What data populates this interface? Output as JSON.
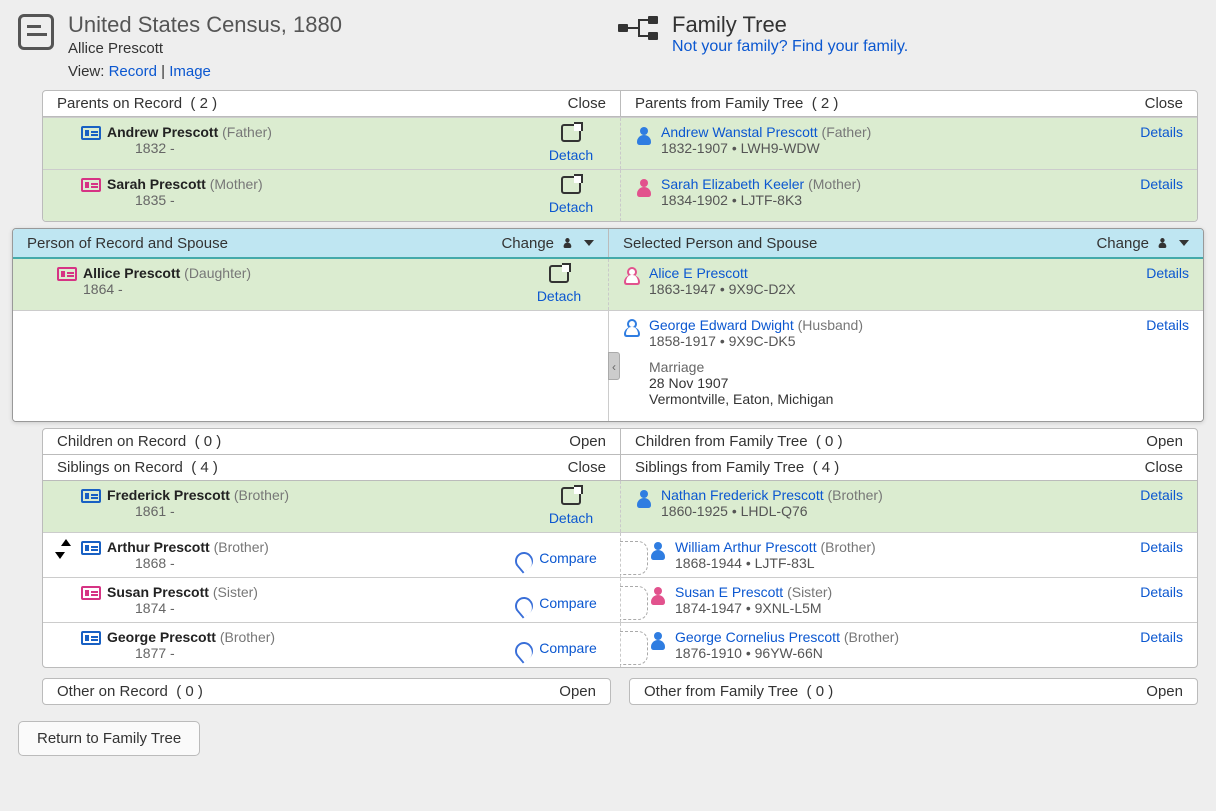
{
  "labels": {
    "view": "View:",
    "record": "Record",
    "image": "Image",
    "close": "Close",
    "open": "Open",
    "detach": "Detach",
    "compare": "Compare",
    "details": "Details",
    "change": "Change",
    "return": "Return to Family Tree"
  },
  "record_header": {
    "title": "United States Census, 1880",
    "person": "Allice Prescott"
  },
  "tree_header": {
    "title": "Family Tree",
    "prompt": "Not your family? Find your family."
  },
  "sections": {
    "parents_rec": {
      "title": "Parents on Record",
      "count": "( 2 )",
      "action": "Close"
    },
    "parents_tree": {
      "title": "Parents from Family Tree",
      "count": "( 2 )",
      "action": "Close"
    },
    "focus_rec": {
      "title": "Person of Record and Spouse",
      "action": "Change"
    },
    "focus_tree": {
      "title": "Selected Person and Spouse",
      "action": "Change"
    },
    "children_rec": {
      "title": "Children on Record",
      "count": "( 0 )",
      "action": "Open"
    },
    "children_tree": {
      "title": "Children from Family Tree",
      "count": "( 0 )",
      "action": "Open"
    },
    "siblings_rec": {
      "title": "Siblings on Record",
      "count": "( 4 )",
      "action": "Close"
    },
    "siblings_tree": {
      "title": "Siblings from Family Tree",
      "count": "( 4 )",
      "action": "Close"
    },
    "other_rec": {
      "title": "Other on Record",
      "count": "( 0 )",
      "action": "Open"
    },
    "other_tree": {
      "title": "Other from Family Tree",
      "count": "( 0 )",
      "action": "Open"
    }
  },
  "parents": {
    "rec": {
      "father": {
        "name": "Andrew Prescott",
        "rel": "(Father)",
        "life": "1832 -"
      },
      "mother": {
        "name": "Sarah Prescott",
        "rel": "(Mother)",
        "life": "1835 -"
      }
    },
    "tree": {
      "father": {
        "name": "Andrew Wanstal Prescott",
        "rel": "(Father)",
        "meta": "1832-1907 • LWH9-WDW"
      },
      "mother": {
        "name": "Sarah Elizabeth Keeler",
        "rel": "(Mother)",
        "meta": "1834-1902 • LJTF-8K3"
      }
    }
  },
  "focus": {
    "rec": {
      "name": "Allice Prescott",
      "rel": "(Daughter)",
      "life": "1864 -"
    },
    "tree": {
      "name": "Alice E Prescott",
      "meta": "1863-1947 • 9X9C-D2X"
    },
    "spouse_tree": {
      "name": "George Edward Dwight",
      "rel": "(Husband)",
      "meta": "1858-1917 • 9X9C-DK5"
    },
    "marriage": {
      "label": "Marriage",
      "date": "28 Nov 1907",
      "place": "Vermontville, Eaton, Michigan"
    }
  },
  "siblings": [
    {
      "match": true,
      "rec": {
        "name": "Frederick Prescott",
        "rel": "(Brother)",
        "life": "1861 -",
        "gender": "m"
      },
      "tree": {
        "name": "Nathan Frederick Prescott",
        "rel": "(Brother)",
        "meta": "1860-1925 • LHDL-Q76",
        "gender": "m"
      }
    },
    {
      "match": false,
      "swap": true,
      "rec": {
        "name": "Arthur Prescott",
        "rel": "(Brother)",
        "life": "1868 -",
        "gender": "m"
      },
      "tree": {
        "name": "William Arthur Prescott",
        "rel": "(Brother)",
        "meta": "1868-1944 • LJTF-83L",
        "gender": "m"
      }
    },
    {
      "match": false,
      "rec": {
        "name": "Susan Prescott",
        "rel": "(Sister)",
        "life": "1874 -",
        "gender": "f"
      },
      "tree": {
        "name": "Susan E Prescott",
        "rel": "(Sister)",
        "meta": "1874-1947 • 9XNL-L5M",
        "gender": "f"
      }
    },
    {
      "match": false,
      "rec": {
        "name": "George Prescott",
        "rel": "(Brother)",
        "life": "1877 -",
        "gender": "m"
      },
      "tree": {
        "name": "George Cornelius Prescott",
        "rel": "(Brother)",
        "meta": "1876-1910 • 96YW-66N",
        "gender": "m"
      }
    }
  ]
}
